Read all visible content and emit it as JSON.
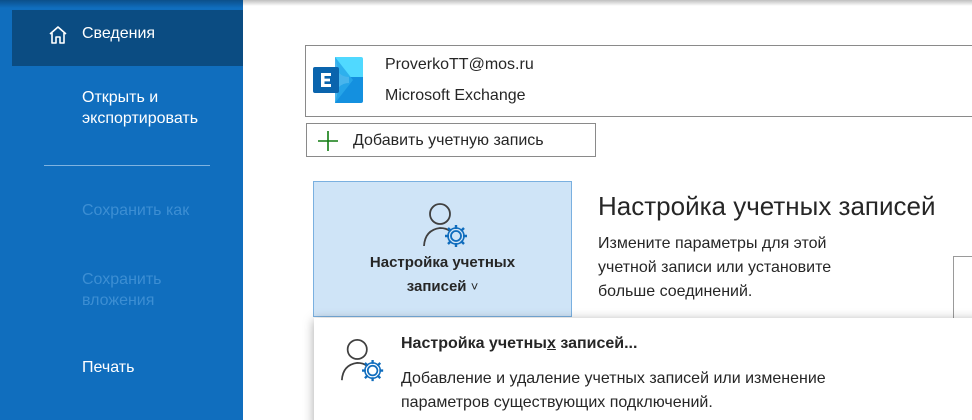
{
  "sidebar": {
    "items": [
      {
        "label": "Сведения",
        "state": "selected"
      },
      {
        "label_line1": "Открыть и",
        "label_line2": "экспортировать",
        "state": "normal"
      },
      {
        "label": "Сохранить как",
        "state": "disabled"
      },
      {
        "label_line1": "Сохранить",
        "label_line2": "вложения",
        "state": "disabled"
      },
      {
        "label": "Печать",
        "state": "normal"
      }
    ],
    "icons": {
      "home": "home-icon"
    }
  },
  "account": {
    "email": "ProverkoTT@mos.ru",
    "type": "Microsoft Exchange",
    "icon": "exchange-logo-icon"
  },
  "add_account": {
    "label": "Добавить учетную запись",
    "icon": "plus-icon"
  },
  "settings_tile": {
    "line1": "Настройка учетных",
    "line2": "записей",
    "chevron": "˅",
    "icon": "account-settings-icon"
  },
  "section": {
    "title": "Настройка учетных записей",
    "desc_line1": "Измените параметры для этой",
    "desc_line2": "учетной записи или установите",
    "desc_line3": "больше соединений."
  },
  "dropdown": {
    "title_before": "Настройка учетны",
    "title_underlined": "х",
    "title_after": " записей...",
    "desc_line1": "Добавление и удаление учетных записей или изменение",
    "desc_line2": "параметров существующих подключений.",
    "icon": "account-settings-icon"
  },
  "colors": {
    "sidebar_bg": "#106ebe",
    "sidebar_selected": "#0b4c82",
    "sidebar_disabled_text": "#3c8ed3",
    "tile_bg": "#cfe4f7",
    "accent_green": "#107c10",
    "exchange_blue": "#0a64ad"
  }
}
